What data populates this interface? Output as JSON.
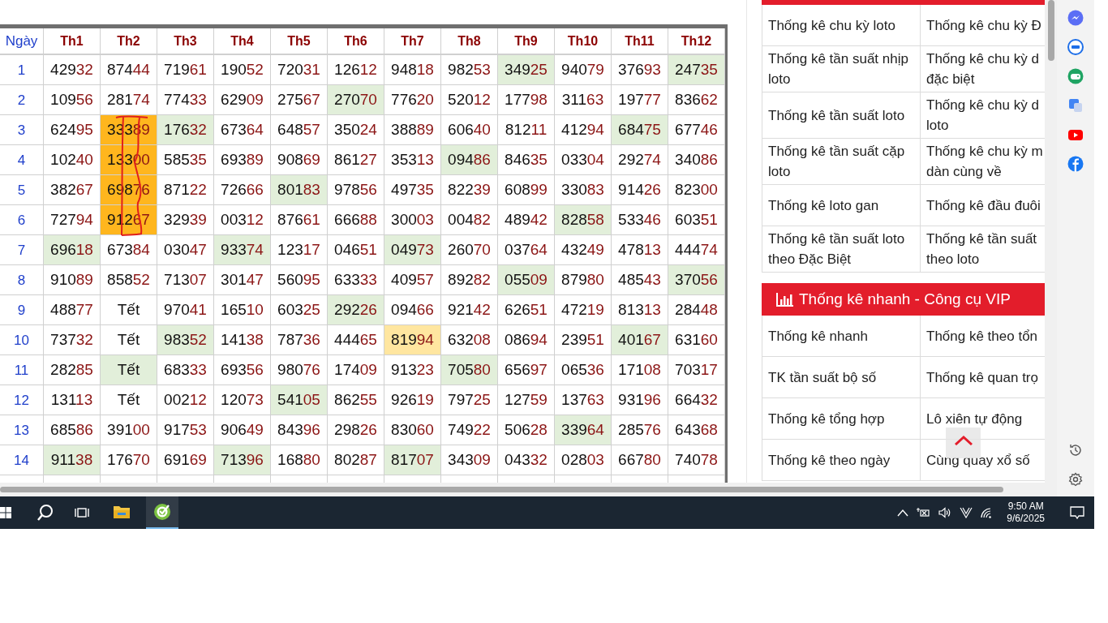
{
  "table": {
    "columns": [
      "Ngày",
      "Th1",
      "Th2",
      "Th3",
      "Th4",
      "Th5",
      "Th6",
      "Th7",
      "Th8",
      "Th9",
      "Th10",
      "Th11",
      "Th12"
    ],
    "rows": [
      {
        "cells": [
          {
            "text": "1",
            "kind": "day"
          },
          {
            "text": "42932",
            "kind": "number",
            "color": "#ffffff"
          },
          {
            "text": "87444",
            "kind": "number",
            "color": "#ffffff"
          },
          {
            "text": "71961",
            "kind": "number",
            "color": "#ffffff"
          },
          {
            "text": "19052",
            "kind": "number",
            "color": "#ffffff"
          },
          {
            "text": "72031",
            "kind": "number",
            "color": "#ffffff"
          },
          {
            "text": "12612",
            "kind": "number",
            "color": "#ffffff"
          },
          {
            "text": "94818",
            "kind": "number",
            "color": "#ffffff"
          },
          {
            "text": "98253",
            "kind": "number",
            "color": "#ffffff"
          },
          {
            "text": "34925",
            "kind": "number",
            "color": "#e2efda"
          },
          {
            "text": "94079",
            "kind": "number",
            "color": "#ffffff"
          },
          {
            "text": "37693",
            "kind": "number",
            "color": "#ffffff"
          },
          {
            "text": "24735",
            "kind": "number",
            "color": "#e2efda"
          }
        ]
      },
      {
        "cells": [
          {
            "text": "2",
            "kind": "day"
          },
          {
            "text": "10956",
            "kind": "number",
            "color": "#ffffff"
          },
          {
            "text": "28174",
            "kind": "number",
            "color": "#ffffff"
          },
          {
            "text": "77433",
            "kind": "number",
            "color": "#ffffff"
          },
          {
            "text": "62909",
            "kind": "number",
            "color": "#ffffff"
          },
          {
            "text": "27567",
            "kind": "number",
            "color": "#ffffff"
          },
          {
            "text": "27070",
            "kind": "number",
            "color": "#e2efda"
          },
          {
            "text": "77620",
            "kind": "number",
            "color": "#ffffff"
          },
          {
            "text": "52012",
            "kind": "number",
            "color": "#ffffff"
          },
          {
            "text": "17798",
            "kind": "number",
            "color": "#ffffff"
          },
          {
            "text": "31163",
            "kind": "number",
            "color": "#ffffff"
          },
          {
            "text": "19777",
            "kind": "number",
            "color": "#ffffff"
          },
          {
            "text": "83662",
            "kind": "number",
            "color": "#ffffff"
          }
        ]
      },
      {
        "cells": [
          {
            "text": "3",
            "kind": "day"
          },
          {
            "text": "62495",
            "kind": "number",
            "color": "#ffffff"
          },
          {
            "text": "33389",
            "kind": "number",
            "color": "#ffb61e"
          },
          {
            "text": "17632",
            "kind": "number",
            "color": "#e2efda"
          },
          {
            "text": "67364",
            "kind": "number",
            "color": "#ffffff"
          },
          {
            "text": "64857",
            "kind": "number",
            "color": "#ffffff"
          },
          {
            "text": "35024",
            "kind": "number",
            "color": "#ffffff"
          },
          {
            "text": "38889",
            "kind": "number",
            "color": "#ffffff"
          },
          {
            "text": "60640",
            "kind": "number",
            "color": "#ffffff"
          },
          {
            "text": "81211",
            "kind": "number",
            "color": "#ffffff"
          },
          {
            "text": "41294",
            "kind": "number",
            "color": "#ffffff"
          },
          {
            "text": "68475",
            "kind": "number",
            "color": "#e2efda"
          },
          {
            "text": "67746",
            "kind": "number",
            "color": "#ffffff"
          }
        ]
      },
      {
        "cells": [
          {
            "text": "4",
            "kind": "day"
          },
          {
            "text": "10240",
            "kind": "number",
            "color": "#ffffff"
          },
          {
            "text": "13300",
            "kind": "number",
            "color": "#ffb61e"
          },
          {
            "text": "58535",
            "kind": "number",
            "color": "#ffffff"
          },
          {
            "text": "69389",
            "kind": "number",
            "color": "#ffffff"
          },
          {
            "text": "90869",
            "kind": "number",
            "color": "#ffffff"
          },
          {
            "text": "86127",
            "kind": "number",
            "color": "#ffffff"
          },
          {
            "text": "35313",
            "kind": "number",
            "color": "#ffffff"
          },
          {
            "text": "09486",
            "kind": "number",
            "color": "#e2efda"
          },
          {
            "text": "84635",
            "kind": "number",
            "color": "#ffffff"
          },
          {
            "text": "03304",
            "kind": "number",
            "color": "#ffffff"
          },
          {
            "text": "29274",
            "kind": "number",
            "color": "#ffffff"
          },
          {
            "text": "34086",
            "kind": "number",
            "color": "#ffffff"
          }
        ]
      },
      {
        "cells": [
          {
            "text": "5",
            "kind": "day"
          },
          {
            "text": "38267",
            "kind": "number",
            "color": "#ffffff"
          },
          {
            "text": "69876",
            "kind": "number",
            "color": "#ffb61e"
          },
          {
            "text": "87122",
            "kind": "number",
            "color": "#ffffff"
          },
          {
            "text": "72666",
            "kind": "number",
            "color": "#ffffff"
          },
          {
            "text": "80183",
            "kind": "number",
            "color": "#e2efda"
          },
          {
            "text": "97856",
            "kind": "number",
            "color": "#ffffff"
          },
          {
            "text": "49735",
            "kind": "number",
            "color": "#ffffff"
          },
          {
            "text": "82239",
            "kind": "number",
            "color": "#ffffff"
          },
          {
            "text": "60899",
            "kind": "number",
            "color": "#ffffff"
          },
          {
            "text": "33083",
            "kind": "number",
            "color": "#ffffff"
          },
          {
            "text": "91426",
            "kind": "number",
            "color": "#ffffff"
          },
          {
            "text": "82300",
            "kind": "number",
            "color": "#ffffff"
          }
        ]
      },
      {
        "cells": [
          {
            "text": "6",
            "kind": "day"
          },
          {
            "text": "72794",
            "kind": "number",
            "color": "#ffffff"
          },
          {
            "text": "91267",
            "kind": "number",
            "color": "#ffb61e"
          },
          {
            "text": "32939",
            "kind": "number",
            "color": "#ffffff"
          },
          {
            "text": "00312",
            "kind": "number",
            "color": "#ffffff"
          },
          {
            "text": "87661",
            "kind": "number",
            "color": "#ffffff"
          },
          {
            "text": "66688",
            "kind": "number",
            "color": "#ffffff"
          },
          {
            "text": "30003",
            "kind": "number",
            "color": "#ffffff"
          },
          {
            "text": "00482",
            "kind": "number",
            "color": "#ffffff"
          },
          {
            "text": "48942",
            "kind": "number",
            "color": "#ffffff"
          },
          {
            "text": "82858",
            "kind": "number",
            "color": "#e2efda"
          },
          {
            "text": "53346",
            "kind": "number",
            "color": "#ffffff"
          },
          {
            "text": "60351",
            "kind": "number",
            "color": "#ffffff"
          }
        ]
      },
      {
        "cells": [
          {
            "text": "7",
            "kind": "day"
          },
          {
            "text": "69618",
            "kind": "number",
            "color": "#e2efda"
          },
          {
            "text": "67384",
            "kind": "number",
            "color": "#ffffff"
          },
          {
            "text": "03047",
            "kind": "number",
            "color": "#ffffff"
          },
          {
            "text": "93374",
            "kind": "number",
            "color": "#e2efda"
          },
          {
            "text": "12317",
            "kind": "number",
            "color": "#ffffff"
          },
          {
            "text": "04651",
            "kind": "number",
            "color": "#ffffff"
          },
          {
            "text": "04973",
            "kind": "number",
            "color": "#e2efda"
          },
          {
            "text": "26070",
            "kind": "number",
            "color": "#ffffff"
          },
          {
            "text": "03764",
            "kind": "number",
            "color": "#ffffff"
          },
          {
            "text": "43249",
            "kind": "number",
            "color": "#ffffff"
          },
          {
            "text": "47813",
            "kind": "number",
            "color": "#ffffff"
          },
          {
            "text": "44474",
            "kind": "number",
            "color": "#ffffff"
          }
        ]
      },
      {
        "cells": [
          {
            "text": "8",
            "kind": "day"
          },
          {
            "text": "91089",
            "kind": "number",
            "color": "#ffffff"
          },
          {
            "text": "85852",
            "kind": "number",
            "color": "#ffffff"
          },
          {
            "text": "71307",
            "kind": "number",
            "color": "#ffffff"
          },
          {
            "text": "30147",
            "kind": "number",
            "color": "#ffffff"
          },
          {
            "text": "56095",
            "kind": "number",
            "color": "#ffffff"
          },
          {
            "text": "63333",
            "kind": "number",
            "color": "#ffffff"
          },
          {
            "text": "40957",
            "kind": "number",
            "color": "#ffffff"
          },
          {
            "text": "89282",
            "kind": "number",
            "color": "#ffffff"
          },
          {
            "text": "05509",
            "kind": "number",
            "color": "#e2efda"
          },
          {
            "text": "87980",
            "kind": "number",
            "color": "#ffffff"
          },
          {
            "text": "48543",
            "kind": "number",
            "color": "#ffffff"
          },
          {
            "text": "37056",
            "kind": "number",
            "color": "#e2efda"
          }
        ]
      },
      {
        "cells": [
          {
            "text": "9",
            "kind": "day"
          },
          {
            "text": "48877",
            "kind": "number",
            "color": "#ffffff"
          },
          {
            "text": "Tết",
            "kind": "holiday",
            "color": "#ffffff"
          },
          {
            "text": "97041",
            "kind": "number",
            "color": "#ffffff"
          },
          {
            "text": "16510",
            "kind": "number",
            "color": "#ffffff"
          },
          {
            "text": "60325",
            "kind": "number",
            "color": "#ffffff"
          },
          {
            "text": "29226",
            "kind": "number",
            "color": "#e2efda"
          },
          {
            "text": "09466",
            "kind": "number",
            "color": "#ffffff"
          },
          {
            "text": "92142",
            "kind": "number",
            "color": "#ffffff"
          },
          {
            "text": "62651",
            "kind": "number",
            "color": "#ffffff"
          },
          {
            "text": "47219",
            "kind": "number",
            "color": "#ffffff"
          },
          {
            "text": "81313",
            "kind": "number",
            "color": "#ffffff"
          },
          {
            "text": "28448",
            "kind": "number",
            "color": "#ffffff"
          }
        ]
      },
      {
        "cells": [
          {
            "text": "10",
            "kind": "day"
          },
          {
            "text": "73732",
            "kind": "number",
            "color": "#ffffff"
          },
          {
            "text": "Tết",
            "kind": "holiday",
            "color": "#ffffff"
          },
          {
            "text": "98352",
            "kind": "number",
            "color": "#e2efda"
          },
          {
            "text": "14138",
            "kind": "number",
            "color": "#ffffff"
          },
          {
            "text": "78736",
            "kind": "number",
            "color": "#ffffff"
          },
          {
            "text": "44465",
            "kind": "number",
            "color": "#ffffff"
          },
          {
            "text": "81994",
            "kind": "number",
            "color": "#ffe6a0"
          },
          {
            "text": "63208",
            "kind": "number",
            "color": "#ffffff"
          },
          {
            "text": "08694",
            "kind": "number",
            "color": "#ffffff"
          },
          {
            "text": "23951",
            "kind": "number",
            "color": "#ffffff"
          },
          {
            "text": "40167",
            "kind": "number",
            "color": "#e2efda"
          },
          {
            "text": "63160",
            "kind": "number",
            "color": "#ffffff"
          }
        ]
      },
      {
        "cells": [
          {
            "text": "11",
            "kind": "day"
          },
          {
            "text": "28285",
            "kind": "number",
            "color": "#ffffff"
          },
          {
            "text": "Tết",
            "kind": "holiday",
            "color": "#e2efda"
          },
          {
            "text": "68333",
            "kind": "number",
            "color": "#ffffff"
          },
          {
            "text": "69356",
            "kind": "number",
            "color": "#ffffff"
          },
          {
            "text": "98076",
            "kind": "number",
            "color": "#ffffff"
          },
          {
            "text": "17409",
            "kind": "number",
            "color": "#ffffff"
          },
          {
            "text": "91323",
            "kind": "number",
            "color": "#ffffff"
          },
          {
            "text": "70580",
            "kind": "number",
            "color": "#e2efda"
          },
          {
            "text": "65697",
            "kind": "number",
            "color": "#ffffff"
          },
          {
            "text": "06536",
            "kind": "number",
            "color": "#ffffff"
          },
          {
            "text": "17108",
            "kind": "number",
            "color": "#ffffff"
          },
          {
            "text": "70317",
            "kind": "number",
            "color": "#ffffff"
          }
        ]
      },
      {
        "cells": [
          {
            "text": "12",
            "kind": "day"
          },
          {
            "text": "13113",
            "kind": "number",
            "color": "#ffffff"
          },
          {
            "text": "Tết",
            "kind": "holiday",
            "color": "#ffffff"
          },
          {
            "text": "00212",
            "kind": "number",
            "color": "#ffffff"
          },
          {
            "text": "12073",
            "kind": "number",
            "color": "#ffffff"
          },
          {
            "text": "54105",
            "kind": "number",
            "color": "#e2efda"
          },
          {
            "text": "86255",
            "kind": "number",
            "color": "#ffffff"
          },
          {
            "text": "92619",
            "kind": "number",
            "color": "#ffffff"
          },
          {
            "text": "79725",
            "kind": "number",
            "color": "#ffffff"
          },
          {
            "text": "12759",
            "kind": "number",
            "color": "#ffffff"
          },
          {
            "text": "13763",
            "kind": "number",
            "color": "#ffffff"
          },
          {
            "text": "93196",
            "kind": "number",
            "color": "#ffffff"
          },
          {
            "text": "66432",
            "kind": "number",
            "color": "#ffffff"
          }
        ]
      },
      {
        "cells": [
          {
            "text": "13",
            "kind": "day"
          },
          {
            "text": "68586",
            "kind": "number",
            "color": "#ffffff"
          },
          {
            "text": "39100",
            "kind": "number",
            "color": "#ffffff"
          },
          {
            "text": "91753",
            "kind": "number",
            "color": "#ffffff"
          },
          {
            "text": "90649",
            "kind": "number",
            "color": "#ffffff"
          },
          {
            "text": "84396",
            "kind": "number",
            "color": "#ffffff"
          },
          {
            "text": "29826",
            "kind": "number",
            "color": "#ffffff"
          },
          {
            "text": "83060",
            "kind": "number",
            "color": "#ffffff"
          },
          {
            "text": "74922",
            "kind": "number",
            "color": "#ffffff"
          },
          {
            "text": "50628",
            "kind": "number",
            "color": "#ffffff"
          },
          {
            "text": "33964",
            "kind": "number",
            "color": "#e2efda"
          },
          {
            "text": "28576",
            "kind": "number",
            "color": "#ffffff"
          },
          {
            "text": "64368",
            "kind": "number",
            "color": "#ffffff"
          }
        ]
      },
      {
        "cells": [
          {
            "text": "14",
            "kind": "day"
          },
          {
            "text": "91138",
            "kind": "number",
            "color": "#e2efda"
          },
          {
            "text": "17670",
            "kind": "number",
            "color": "#ffffff"
          },
          {
            "text": "69169",
            "kind": "number",
            "color": "#ffffff"
          },
          {
            "text": "71396",
            "kind": "number",
            "color": "#e2efda"
          },
          {
            "text": "16880",
            "kind": "number",
            "color": "#ffffff"
          },
          {
            "text": "80287",
            "kind": "number",
            "color": "#ffffff"
          },
          {
            "text": "81707",
            "kind": "number",
            "color": "#e2efda"
          },
          {
            "text": "34309",
            "kind": "number",
            "color": "#ffffff"
          },
          {
            "text": "04332",
            "kind": "number",
            "color": "#ffffff"
          },
          {
            "text": "02803",
            "kind": "number",
            "color": "#ffffff"
          },
          {
            "text": "66780",
            "kind": "number",
            "color": "#ffffff"
          },
          {
            "text": "74078",
            "kind": "number",
            "color": "#ffffff"
          }
        ]
      }
    ]
  },
  "side_panel": {
    "sections": [
      {
        "rows": [
          [
            "Thống kê chu kỳ loto",
            "Thống kê chu kỳ Đ"
          ],
          [
            "Thống kê tần suất nhịp\nloto",
            "Thống kê chu kỳ d\nđặc biệt"
          ],
          [
            "Thống kê tần suất loto",
            "Thống kê chu kỳ d\nloto"
          ],
          [
            "Thống kê tần suất cặp\nloto",
            "Thống kê chu kỳ m\ndàn cùng về"
          ],
          [
            "Thống kê loto gan",
            "Thống kê đầu đuôi"
          ],
          [
            "Thống kê tần suất loto\ntheo Đặc Biệt",
            "Thống kê tần suất\ntheo loto"
          ]
        ]
      },
      {
        "title": "Thống kê nhanh - Công cụ VIP",
        "rows": [
          [
            "Thống kê nhanh",
            "Thống kê theo tổn"
          ],
          [
            "TK tần suất bộ số",
            "Thống kê quan trọ"
          ],
          [
            "Thống kê tổng hợp",
            "Lô xiên tự động"
          ],
          [
            "Thống kê theo ngày",
            "Cùng quay xổ số"
          ]
        ]
      }
    ]
  },
  "taskbar": {
    "apps": [
      {
        "kind": "explorer",
        "running": false
      },
      {
        "kind": "app",
        "running": true
      }
    ],
    "time": "9:50 AM",
    "date": "9/6/2025"
  }
}
